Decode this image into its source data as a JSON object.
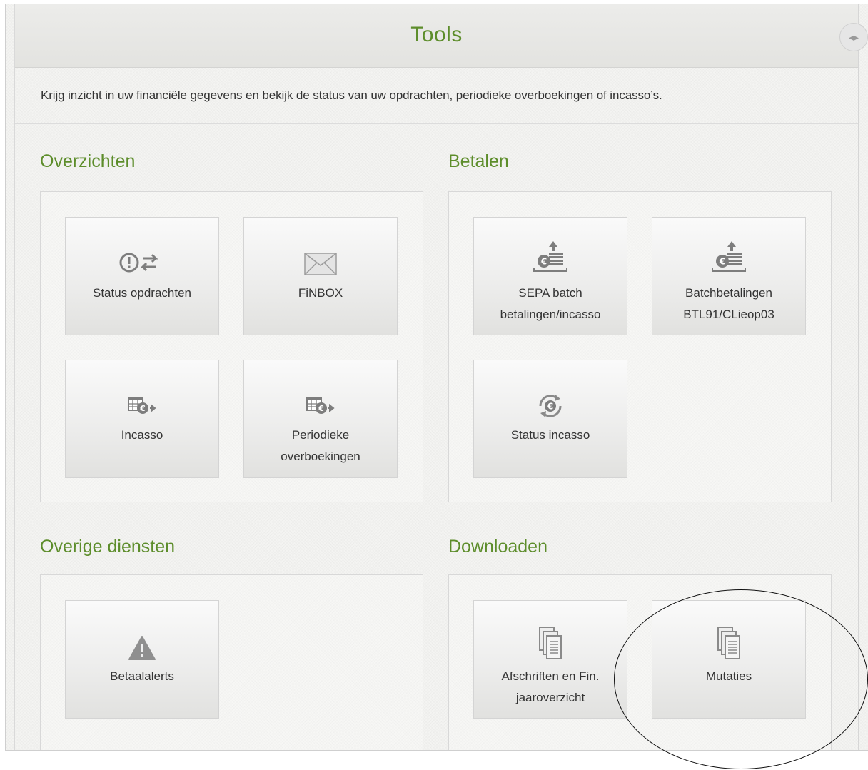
{
  "header": {
    "title": "Tools"
  },
  "intro": "Krijg inzicht in uw financiële gegevens en bekijk de status van uw opdrachten, periodieke overboekingen of incasso’s.",
  "sections": {
    "overzichten": {
      "title": "Overzichten",
      "tiles": {
        "status_opdrachten": {
          "label": "Status opdrachten",
          "icon": "status-exchange-icon"
        },
        "finbox": {
          "label": "FiNBOX",
          "icon": "envelope-icon"
        },
        "incasso": {
          "label": "Incasso",
          "icon": "calendar-euro-icon"
        },
        "periodieke": {
          "label_1": "Periodieke",
          "label_2": "overboekingen",
          "icon": "calendar-euro-icon"
        }
      }
    },
    "betalen": {
      "title": "Betalen",
      "tiles": {
        "sepa": {
          "label_1": "SEPA batch",
          "label_2": "betalingen/incasso",
          "icon": "euro-upload-icon"
        },
        "batch": {
          "label_1": "Batchbetalingen",
          "label_2": "BTL91/CLieop03",
          "icon": "euro-upload-icon"
        },
        "status_incasso": {
          "label": "Status incasso",
          "icon": "euro-refresh-icon"
        }
      }
    },
    "overige": {
      "title": "Overige diensten",
      "tiles": {
        "betaalalerts": {
          "label": "Betaalalerts",
          "icon": "warning-icon"
        }
      }
    },
    "downloaden": {
      "title": "Downloaden",
      "tiles": {
        "afschriften": {
          "label_1": "Afschriften en Fin.",
          "label_2": "jaaroverzicht",
          "icon": "documents-icon"
        },
        "mutaties": {
          "label": "Mutaties",
          "icon": "documents-icon"
        }
      }
    }
  },
  "colors": {
    "accent": "#5d8d2b",
    "text": "#333333",
    "icon": "#8a8a8a"
  }
}
